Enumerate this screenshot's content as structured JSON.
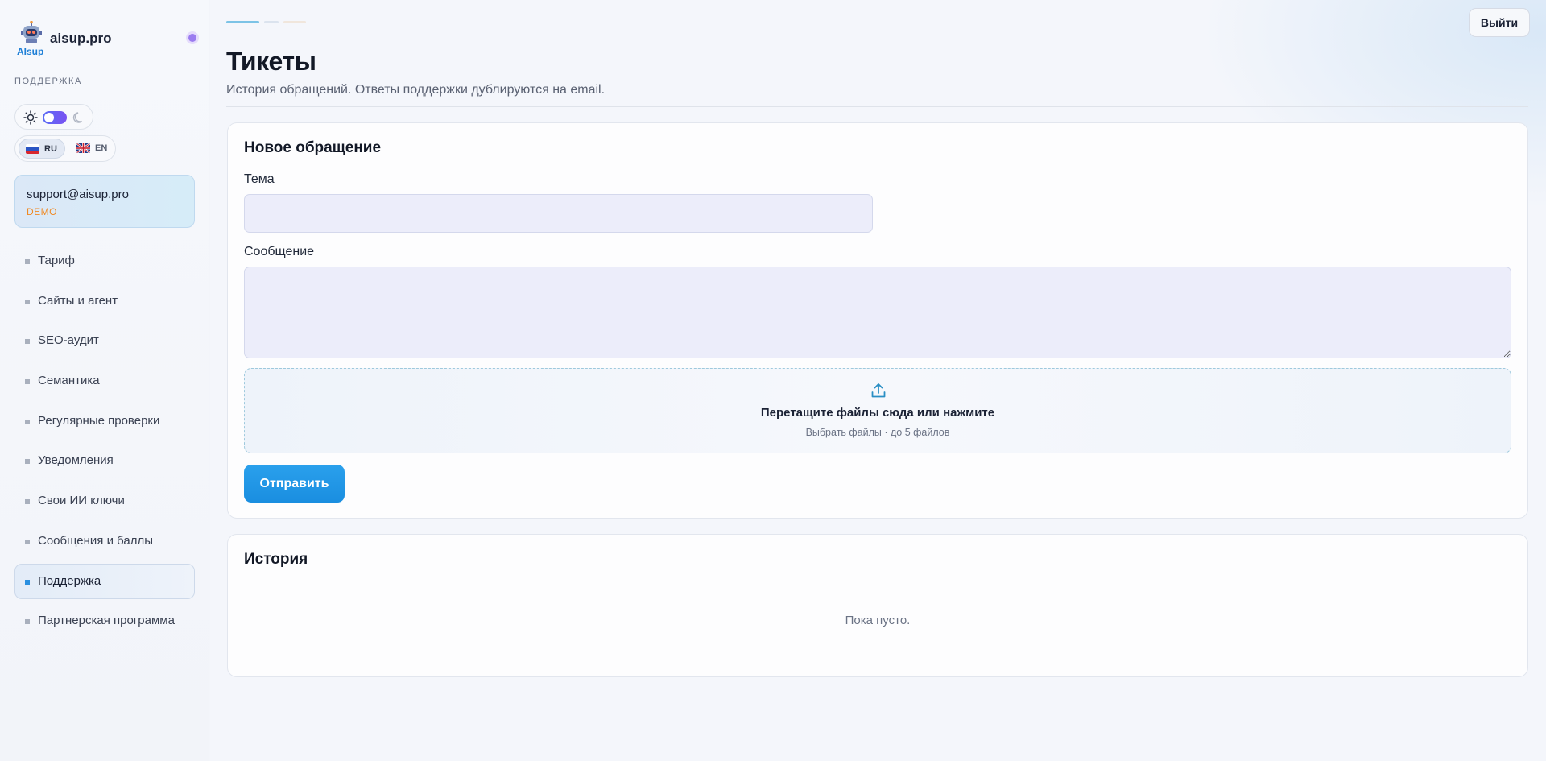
{
  "brand": {
    "name": "aisup.pro",
    "logo_text": "AIsup",
    "status_color": "#9b7cf0"
  },
  "sidebar": {
    "section_label": "ПОДДЕРЖКА",
    "theme": {
      "light_icon": "sun-icon",
      "dark_icon": "moon-icon",
      "mode": "light"
    },
    "languages": [
      {
        "code": "RU",
        "flag": "ru-flag-icon",
        "active": true
      },
      {
        "code": "EN",
        "flag": "gb-flag-icon",
        "active": false
      }
    ],
    "account": {
      "email": "support@aisup.pro",
      "plan": "DEMO"
    },
    "items": [
      {
        "label": "Тариф",
        "active": false
      },
      {
        "label": "Сайты и агент",
        "active": false
      },
      {
        "label": "SEO-аудит",
        "active": false
      },
      {
        "label": "Семантика",
        "active": false
      },
      {
        "label": "Регулярные проверки",
        "active": false
      },
      {
        "label": "Уведомления",
        "active": false
      },
      {
        "label": "Свои ИИ ключи",
        "active": false
      },
      {
        "label": "Сообщения и баллы",
        "active": false
      },
      {
        "label": "Поддержка",
        "active": true
      },
      {
        "label": "Партнерская программа",
        "active": false
      }
    ]
  },
  "header": {
    "logout_label": "Выйти",
    "title": "Тикеты",
    "subtitle": "История обращений. Ответы поддержки дублируются на email."
  },
  "new_ticket": {
    "title": "Новое обращение",
    "subject_label": "Тема",
    "subject_value": "",
    "message_label": "Сообщение",
    "message_value": "",
    "dropzone": {
      "icon": "upload-icon",
      "main_text": "Перетащите файлы сюда или нажмите",
      "sub_text": "Выбрать файлы · до 5 файлов"
    },
    "submit_label": "Отправить"
  },
  "history": {
    "title": "История",
    "empty_text": "Пока пусто."
  },
  "colors": {
    "accent": "#1a8ee0",
    "plan": "#f08a24",
    "active_nav_bullet": "#2a8fe0"
  }
}
